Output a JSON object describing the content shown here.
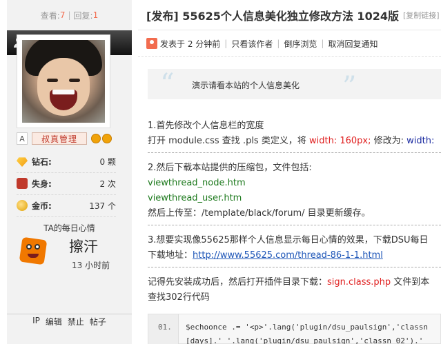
{
  "stats_bar": {
    "views_label": "查看:",
    "views": "7",
    "sep": "|",
    "replies_label": "回复:",
    "replies": "1"
  },
  "user": {
    "name": "admin",
    "badge_letter": "A",
    "group": "叔真管理",
    "stats": [
      {
        "icon": "diamond-icon",
        "label": "钻石:",
        "value": "0 颗"
      },
      {
        "icon": "lost-icon",
        "label": "失身:",
        "value": "2 次"
      },
      {
        "icon": "coin-icon",
        "label": "金币:",
        "value": "137 个"
      }
    ],
    "mood_title": "TA的每日心情",
    "mood": "擦汗",
    "mood_time": "13 小时前",
    "actions": [
      "IP",
      "编辑",
      "禁止",
      "帖子"
    ]
  },
  "thread": {
    "title": "[发布] 55625个人信息美化独立修改方法 1024版",
    "copy_link": "[复制链接]",
    "posted_at": "发表于 2 分钟前",
    "meta_links": [
      "只看该作者",
      "倒序浏览",
      "取消回复通知"
    ],
    "quote": "演示请看本站的个人信息美化"
  },
  "content": {
    "s1_title": "1.首先修改个人信息栏的宽度",
    "s1_text_a": "打开 module.css 查找 .pls 类定义，将 ",
    "s1_red": "width: 160px;",
    "s1_text_b": " 修改为: ",
    "s1_blue": "width:",
    "s2_title": "2.然后下载本站提供的压缩包，文件包括:",
    "s2_file1": "viewthread_node.htm",
    "s2_file2": "viewthread_user.htm",
    "s2_upload": "然后上传至：/template/black/forum/ 目录更新缓存。",
    "s3_title": "3.想要实现像55625那样个人信息显示每日心情的效果，下载DSU每日",
    "s3_link_label": "下载地址：",
    "s3_link": "http://www.55625.com/thread-86-1-1.html",
    "s4_text_a": "记得先安装成功后，然后打开插件目录下载：",
    "s4_red": "sign.class.php",
    "s4_text_b": " 文件到本",
    "s4_find": "查找302行代码"
  },
  "code": {
    "line_no": "01.",
    "line1": "$echoonce .= '<p>'.lang('plugin/dsu_paulsign','classn",
    "line2": "[days].' '.lang('plugin/dsu_paulsign','classn_02').'"
  }
}
